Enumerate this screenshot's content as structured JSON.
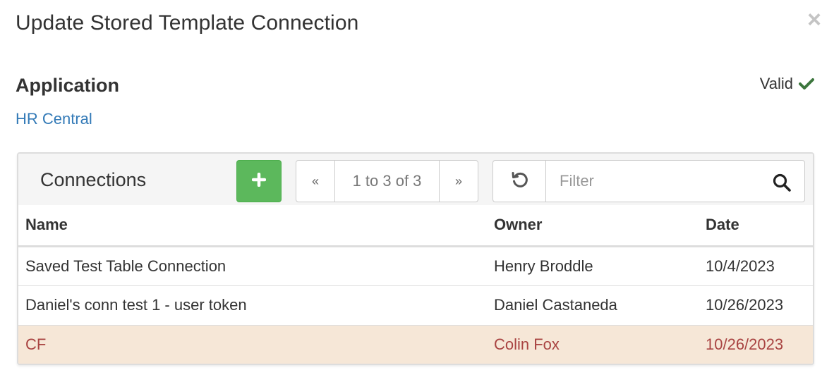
{
  "modal": {
    "title": "Update Stored Template Connection",
    "close_glyph": "×"
  },
  "application": {
    "label": "Application",
    "value": "HR Central",
    "status": "Valid",
    "status_color": "#3c763d"
  },
  "connections": {
    "title": "Connections",
    "add_icon": "plus-icon",
    "pager": {
      "first": "«",
      "info": "1 to 3 of 3",
      "last": "»"
    },
    "filter": {
      "placeholder": "Filter"
    },
    "columns": [
      "Name",
      "Owner",
      "Date"
    ],
    "rows": [
      {
        "name": "Saved Test Table Connection",
        "owner": "Henry Broddle",
        "date": "10/4/2023",
        "selected": false
      },
      {
        "name": "Daniel's conn test 1 - user token",
        "owner": "Daniel Castaneda",
        "date": "10/26/2023",
        "selected": false
      },
      {
        "name": "CF",
        "owner": "Colin Fox",
        "date": "10/26/2023",
        "selected": true
      }
    ]
  },
  "colors": {
    "link": "#337ab7",
    "success_button": "#5cb85c",
    "selected_row_bg": "#f6e7d7",
    "selected_row_text": "#a94442"
  }
}
